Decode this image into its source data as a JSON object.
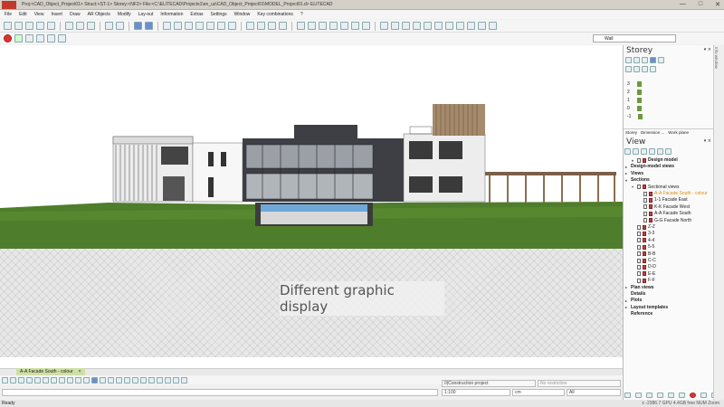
{
  "titlebar": {
    "title": "Proj:<CAD_Object_Project01>  Struct:<ST-1>  Storey:<NF2>  File:<C:\\ELITECAD\\Projects1\\en_us\\CAD_Object_Project01\\MODEL_Project01.d>  ELITECAD",
    "minimize": "—",
    "maximize": "□",
    "close": "✕"
  },
  "menu": [
    "File",
    "Edit",
    "View",
    "Insert",
    "Draw",
    "AR Objects",
    "Modify",
    "Lay-out",
    "Information",
    "Extras",
    "Settings",
    "Window",
    "Key combinations",
    "?"
  ],
  "toolbar": {
    "layer_value": "Wall"
  },
  "viewport": {
    "overlay_text": "Different graphic display"
  },
  "view_tab": {
    "label": "A-A Facade South - colour",
    "close": "×"
  },
  "inputs": {
    "construction_project": "0|Construction project",
    "restriction": "No restriction",
    "scale": "1:100",
    "unit": "cm",
    "filter": "All"
  },
  "statusbar": {
    "left": "Ready",
    "right": "x -2386.7     GPU 4.4GB free     NUM  Zoom"
  },
  "storey_panel": {
    "title": "Storey",
    "close": "▾ ×",
    "levels": [
      "3",
      "2",
      "1",
      "0",
      "-1"
    ],
    "tabs": [
      "Storey",
      "Dimension ...",
      "Work plane"
    ]
  },
  "view_panel": {
    "title": "View",
    "close": "▾ ×",
    "tree": [
      {
        "label": "Design model",
        "bold": true,
        "depth": 1,
        "twisty": "▾",
        "icon": "r"
      },
      {
        "label": "Design-model views",
        "bold": true,
        "depth": 0,
        "twisty": "▸",
        "icon": ""
      },
      {
        "label": "Views",
        "bold": true,
        "depth": 0,
        "twisty": "▸",
        "icon": ""
      },
      {
        "label": "Sections",
        "bold": true,
        "depth": 0,
        "twisty": "▾",
        "icon": ""
      },
      {
        "label": "Sectional views",
        "bold": false,
        "depth": 1,
        "twisty": "▾",
        "icon": "f"
      },
      {
        "label": "A-A Facade South - colour",
        "bold": false,
        "depth": 2,
        "twisty": "",
        "icon": "r",
        "selected": true
      },
      {
        "label": "1-1 Facade East",
        "bold": false,
        "depth": 2,
        "twisty": "",
        "icon": "r"
      },
      {
        "label": "K-K Facade West",
        "bold": false,
        "depth": 2,
        "twisty": "",
        "icon": "r"
      },
      {
        "label": "A-A Facade South",
        "bold": false,
        "depth": 2,
        "twisty": "",
        "icon": "r"
      },
      {
        "label": "G-G Facade North",
        "bold": false,
        "depth": 2,
        "twisty": "",
        "icon": "r"
      },
      {
        "label": "Z-Z",
        "bold": false,
        "depth": 1,
        "twisty": "",
        "icon": "r"
      },
      {
        "label": "3-3",
        "bold": false,
        "depth": 1,
        "twisty": "",
        "icon": "r"
      },
      {
        "label": "4-4",
        "bold": false,
        "depth": 1,
        "twisty": "",
        "icon": "r"
      },
      {
        "label": "5-5",
        "bold": false,
        "depth": 1,
        "twisty": "",
        "icon": "r"
      },
      {
        "label": "B-B",
        "bold": false,
        "depth": 1,
        "twisty": "",
        "icon": "r"
      },
      {
        "label": "C-C",
        "bold": false,
        "depth": 1,
        "twisty": "",
        "icon": "r"
      },
      {
        "label": "D-D",
        "bold": false,
        "depth": 1,
        "twisty": "",
        "icon": "r"
      },
      {
        "label": "E-E",
        "bold": false,
        "depth": 1,
        "twisty": "",
        "icon": "r"
      },
      {
        "label": "F-F",
        "bold": false,
        "depth": 1,
        "twisty": "",
        "icon": "r"
      },
      {
        "label": "Plan views",
        "bold": true,
        "depth": 0,
        "twisty": "▸",
        "icon": ""
      },
      {
        "label": "Details",
        "bold": true,
        "depth": 0,
        "twisty": "",
        "icon": ""
      },
      {
        "label": "Plots",
        "bold": true,
        "depth": 0,
        "twisty": "▸",
        "icon": ""
      },
      {
        "label": "Layout templates",
        "bold": true,
        "depth": 0,
        "twisty": "▸",
        "icon": ""
      },
      {
        "label": "Reference",
        "bold": true,
        "depth": 0,
        "twisty": "",
        "icon": ""
      }
    ]
  },
  "side_tab": {
    "label": "Info window"
  },
  "colors": {
    "accent": "#e08a00",
    "lawn": "#4e7d2b",
    "pool": "#6fa8d8",
    "dark_facade": "#3d3f45"
  }
}
